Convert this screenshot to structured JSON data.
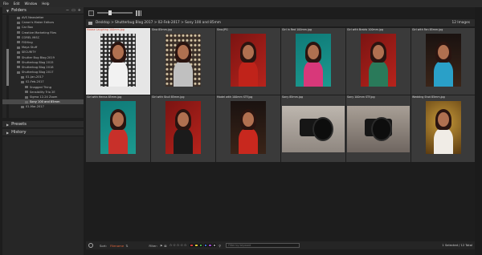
{
  "menu": [
    "File",
    "Edit",
    "Window",
    "Help"
  ],
  "panels": {
    "folders": "Folders",
    "presets": "Presets",
    "history": "History"
  },
  "folder_tree": [
    {
      "label": "AVS Newsletter",
      "sel": false
    },
    {
      "label": "Canon's Maker Editors",
      "sel": false
    },
    {
      "label": "Car Box",
      "sel": false
    },
    {
      "label": "Creative Marketing Files",
      "sel": false
    },
    {
      "label": "COREL MISC",
      "sel": false
    },
    {
      "label": "FISHing",
      "sel": false
    },
    {
      "label": "Maya Stuff",
      "sel": false
    },
    {
      "label": "SECURITY",
      "sel": false
    },
    {
      "label": "Shutter Bug Blog 2019",
      "sel": false
    },
    {
      "label": "Shutterbug Blog 2015",
      "sel": false
    },
    {
      "label": "Shutterbug Blog 2018",
      "sel": false
    },
    {
      "label": "Shutterbug Blog 2017",
      "sel": false
    },
    {
      "label": "01-Jan-2017",
      "sel": false
    },
    {
      "label": "02-Feb-2017",
      "sel": false
    },
    {
      "label": "Snagged Thing",
      "sel": false
    },
    {
      "label": "Sensibility Trio 2E",
      "sel": false
    },
    {
      "label": "Sigma 12-24 Zoom",
      "sel": false
    },
    {
      "label": "Sony 100 and 85mm",
      "sel": true
    },
    {
      "label": "01-Mar-2017",
      "sel": false
    }
  ],
  "path": "Desktop > Shutterbug Blog 2017 > 02-Feb-2017 > Sony 100 and 85mm",
  "image_count": "12 Images",
  "thumbnails": [
    {
      "caption": "Moose Laughing 100mm.jpg",
      "selected": true,
      "scene": "lights-bw",
      "accent": "#f2f2f2"
    },
    {
      "caption": "Sina 85mm.jpg",
      "selected": false,
      "scene": "lights",
      "accent": "#c0c0c0"
    },
    {
      "caption": "Sina.JPG",
      "selected": false,
      "scene": "red",
      "accent": "#c0231a"
    },
    {
      "caption": "Girl in Red 100mm.jpg",
      "selected": false,
      "scene": "teal",
      "accent": "#d8387a"
    },
    {
      "caption": "Girl with Braids 100mm.jpg",
      "selected": false,
      "scene": "red",
      "accent": "#2a7a5a"
    },
    {
      "caption": "Girl with Fan 85mm.jpg",
      "selected": false,
      "scene": "dark",
      "accent": "#2aa0c8"
    },
    {
      "caption": "Girl with Henna 85mm.jpg",
      "selected": false,
      "scene": "teal",
      "accent": "#c8302a"
    },
    {
      "caption": "Girl with Skull 85mm.jpg",
      "selected": false,
      "scene": "red",
      "accent": "#1b1b1b"
    },
    {
      "caption": "Model with 100mm STF.jpg",
      "selected": false,
      "scene": "dark",
      "accent": "#c8281e"
    },
    {
      "caption": "Sony 85mm.jpg",
      "selected": false,
      "scene": "camera",
      "accent": "#222"
    },
    {
      "caption": "Sony 100mm STF.jpg",
      "selected": false,
      "scene": "camera2",
      "accent": "#222"
    },
    {
      "caption": "Wedding Shot 85mm.jpg",
      "selected": false,
      "scene": "gold",
      "accent": "#f0ece6"
    }
  ],
  "bottom": {
    "sort_label": "Sort:",
    "sort_value": "Filename",
    "filter_label": "Filter:",
    "stars": "☆☆☆☆☆",
    "search_placeholder": "Filter by keyword",
    "selection": "1 Selected / 12 Total"
  },
  "label_colors": [
    "#d13c3c",
    "#e0c93a",
    "#4cae4c",
    "#3a6fd1",
    "#9b47c8",
    "#8a8a8a"
  ]
}
